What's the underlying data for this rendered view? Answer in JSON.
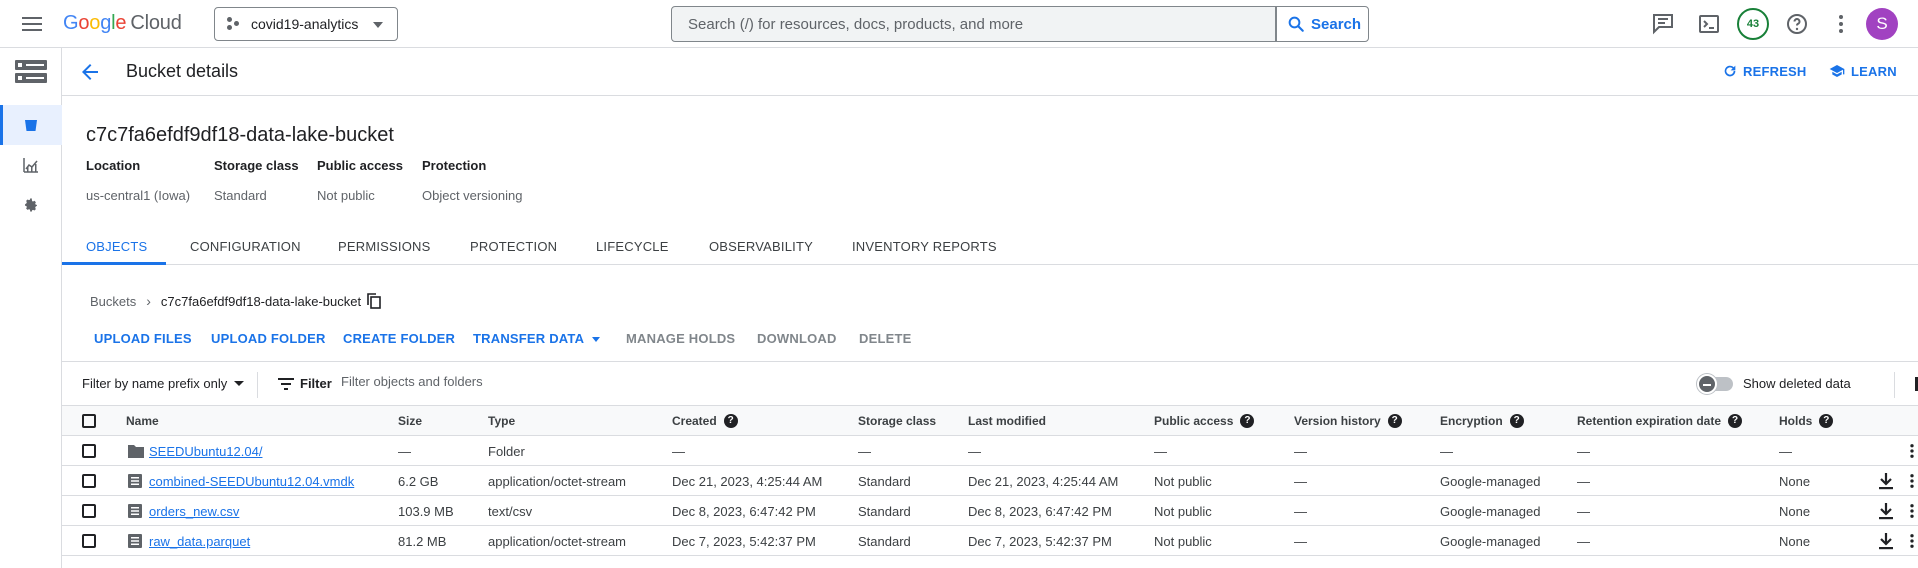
{
  "topbar": {
    "logo": {
      "g": "G",
      "o1": "o",
      "o2": "o",
      "g2": "g",
      "l": "l",
      "e": "e",
      "cloud": "Cloud"
    },
    "project": "covid19-analytics",
    "search_placeholder": "Search (/) for resources, docs, products, and more",
    "search_button": "Search",
    "notification_count": "43",
    "avatar_letter": "S",
    "icons": [
      "menu-icon",
      "notes-icon",
      "terminal-icon",
      "help-icon",
      "more-vert-icon"
    ]
  },
  "header": {
    "title": "Bucket details",
    "refresh": "REFRESH",
    "learn": "LEARN"
  },
  "bucket": {
    "name": "c7c7fa6efdf9df18-data-lake-bucket",
    "meta": [
      {
        "key": "Location",
        "value": "us-central1 (Iowa)"
      },
      {
        "key": "Storage class",
        "value": "Standard"
      },
      {
        "key": "Public access",
        "value": "Not public"
      },
      {
        "key": "Protection",
        "value": "Object versioning"
      }
    ]
  },
  "tabs": [
    "OBJECTS",
    "CONFIGURATION",
    "PERMISSIONS",
    "PROTECTION",
    "LIFECYCLE",
    "OBSERVABILITY",
    "INVENTORY REPORTS"
  ],
  "breadcrumb": {
    "root": "Buckets",
    "current": "c7c7fa6efdf9df18-data-lake-bucket"
  },
  "toolbar": {
    "upload_files": "UPLOAD FILES",
    "upload_folder": "UPLOAD FOLDER",
    "create_folder": "CREATE FOLDER",
    "transfer_data": "TRANSFER DATA",
    "manage_holds": "MANAGE HOLDS",
    "download": "DOWNLOAD",
    "delete": "DELETE"
  },
  "filter": {
    "mode": "Filter by name prefix only",
    "label": "Filter",
    "placeholder": "Filter objects and folders",
    "show_deleted": "Show deleted data"
  },
  "table": {
    "columns": {
      "name": "Name",
      "size": "Size",
      "type": "Type",
      "created": "Created",
      "storage_class": "Storage class",
      "last_modified": "Last modified",
      "public_access": "Public access",
      "version_history": "Version history",
      "encryption": "Encryption",
      "retention": "Retention expiration date",
      "holds": "Holds"
    },
    "rows": [
      {
        "name": "SEEDUbuntu12.04/",
        "kind": "folder",
        "size": "—",
        "type": "Folder",
        "created": "—",
        "storage_class": "—",
        "last_modified": "—",
        "public_access": "—",
        "version_history": "—",
        "encryption": "—",
        "retention": "—",
        "holds": "—"
      },
      {
        "name": "combined-SEEDUbuntu12.04.vmdk",
        "kind": "file",
        "size": "6.2 GB",
        "type": "application/octet-stream",
        "created": "Dec 21, 2023, 4:25:44 AM",
        "storage_class": "Standard",
        "last_modified": "Dec 21, 2023, 4:25:44 AM",
        "public_access": "Not public",
        "version_history": "—",
        "encryption": "Google-managed",
        "retention": "—",
        "holds": "None"
      },
      {
        "name": "orders_new.csv",
        "kind": "file",
        "size": "103.9 MB",
        "type": "text/csv",
        "created": "Dec 8, 2023, 6:47:42 PM",
        "storage_class": "Standard",
        "last_modified": "Dec 8, 2023, 6:47:42 PM",
        "public_access": "Not public",
        "version_history": "—",
        "encryption": "Google-managed",
        "retention": "—",
        "holds": "None"
      },
      {
        "name": "raw_data.parquet",
        "kind": "file",
        "size": "81.2 MB",
        "type": "application/octet-stream",
        "created": "Dec 7, 2023, 5:42:37 PM",
        "storage_class": "Standard",
        "last_modified": "Dec 7, 2023, 5:42:37 PM",
        "public_access": "Not public",
        "version_history": "—",
        "encryption": "Google-managed",
        "retention": "—",
        "holds": "None"
      }
    ]
  },
  "colors": {
    "accent": "#1a73e8",
    "badge": "#188038",
    "avatar": "#a142c1"
  }
}
